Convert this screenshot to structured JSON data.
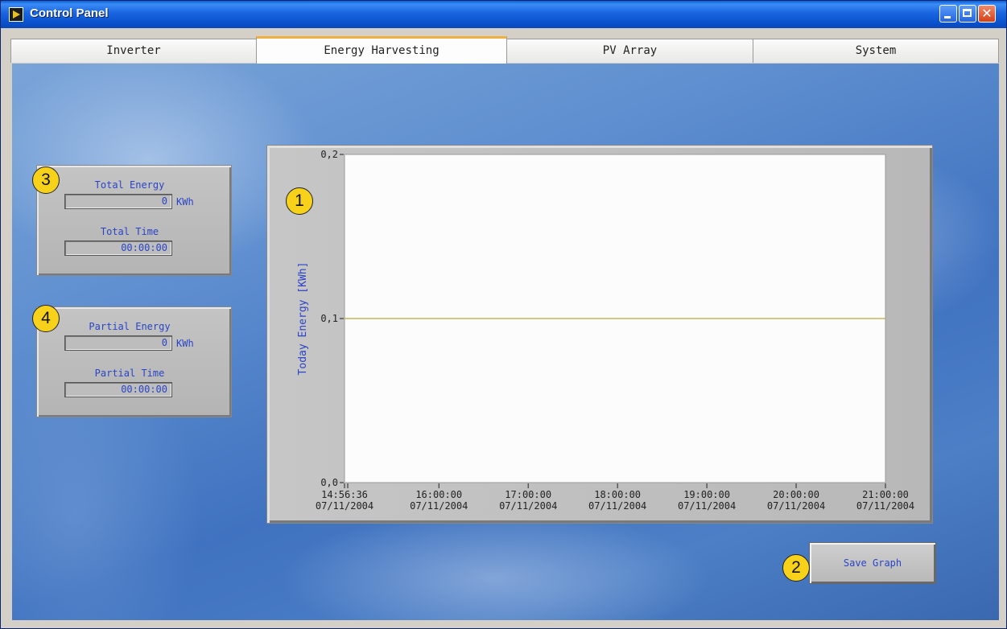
{
  "window": {
    "title": "Control Panel"
  },
  "tabs": [
    {
      "label": "Inverter",
      "active": false
    },
    {
      "label": "Energy Harvesting",
      "active": true
    },
    {
      "label": "PV Array",
      "active": false
    },
    {
      "label": "System",
      "active": false
    }
  ],
  "callouts": {
    "c1": "1",
    "c2": "2",
    "c3": "3",
    "c4": "4"
  },
  "total": {
    "energy_label": "Total Energy",
    "energy_value": "0",
    "energy_unit": "KWh",
    "time_label": "Total Time",
    "time_value": "00:00:00"
  },
  "partial": {
    "energy_label": "Partial Energy",
    "energy_value": "0",
    "energy_unit": "KWh",
    "time_label": "Partial Time",
    "time_value": "00:00:00"
  },
  "save_label": "Save Graph",
  "colors": {
    "label_blue": "#2a44c8",
    "callout_yellow": "#f8d21a",
    "plot_line": "#b8a838"
  },
  "chart_data": {
    "type": "line",
    "ylabel": "Today Energy [KWh]",
    "ylim": [
      0.0,
      0.2
    ],
    "yticks": [
      "0,2",
      "0,1",
      "0,0"
    ],
    "xticks": [
      {
        "time": "14:56:36",
        "date": "07/11/2004"
      },
      {
        "time": "16:00:00",
        "date": "07/11/2004"
      },
      {
        "time": "17:00:00",
        "date": "07/11/2004"
      },
      {
        "time": "18:00:00",
        "date": "07/11/2004"
      },
      {
        "time": "19:00:00",
        "date": "07/11/2004"
      },
      {
        "time": "20:00:00",
        "date": "07/11/2004"
      },
      {
        "time": "21:00:00",
        "date": "07/11/2004"
      }
    ],
    "series": [
      {
        "x": [
          "07/11/2004 14:56:36",
          "07/11/2004 21:00:00"
        ],
        "y": [
          0.1,
          0.1
        ]
      }
    ],
    "grid": false
  }
}
